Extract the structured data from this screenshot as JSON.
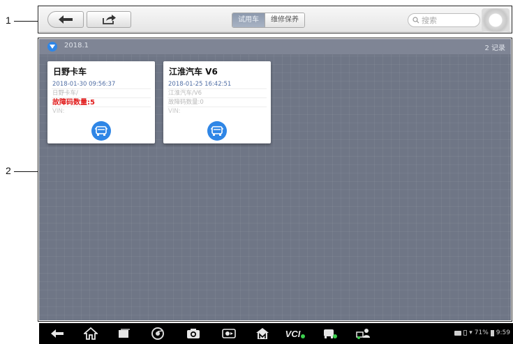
{
  "callouts": [
    {
      "label": "1"
    },
    {
      "label": "2"
    }
  ],
  "toolbar": {
    "back_icon": "back-arrow-icon",
    "share_icon": "share-export-icon",
    "tabs": [
      {
        "label": "试用车",
        "active": true
      },
      {
        "label": "维修保养",
        "active": false
      }
    ],
    "search_placeholder": "搜索",
    "search_icon": "search-icon",
    "home_icon": "home-circle-icon"
  },
  "list": {
    "group_date": "2018.1",
    "group_count": "2 记录",
    "cards": [
      {
        "title": "日野卡车",
        "datetime": "2018-01-30 09:56:37",
        "model_path": "日野卡车/",
        "dtc_text": "故障码数量:5",
        "dtc_alert": true,
        "vin": "VIN:",
        "icon": "vehicle-icon"
      },
      {
        "title": "江淮汽车 V6",
        "datetime": "2018-01-25 16:42:51",
        "model_path": "江淮汽车/V6",
        "dtc_text": "故障码数量:0",
        "dtc_alert": false,
        "vin": "VIN:",
        "icon": "vehicle-icon"
      }
    ]
  },
  "navbar": {
    "items": [
      "back-icon",
      "home-icon",
      "recent-apps-icon",
      "chrome-icon",
      "camera-icon",
      "screen-record-icon",
      "maxifix-icon",
      "vci-icon",
      "vehicle-diag-icon",
      "remote-desk-icon"
    ],
    "vci_label": "VCI",
    "status_battery": "71%",
    "status_time": "9:59"
  },
  "colors": {
    "accent": "#2f86e6",
    "alert": "#e11c1c",
    "workspace": "#6f7686"
  }
}
